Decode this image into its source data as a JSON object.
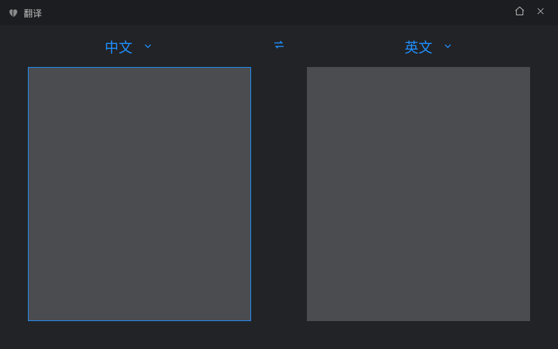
{
  "titlebar": {
    "title": "翻译"
  },
  "languages": {
    "source": "中文",
    "target": "英文"
  },
  "panes": {
    "source_value": "",
    "target_value": ""
  }
}
